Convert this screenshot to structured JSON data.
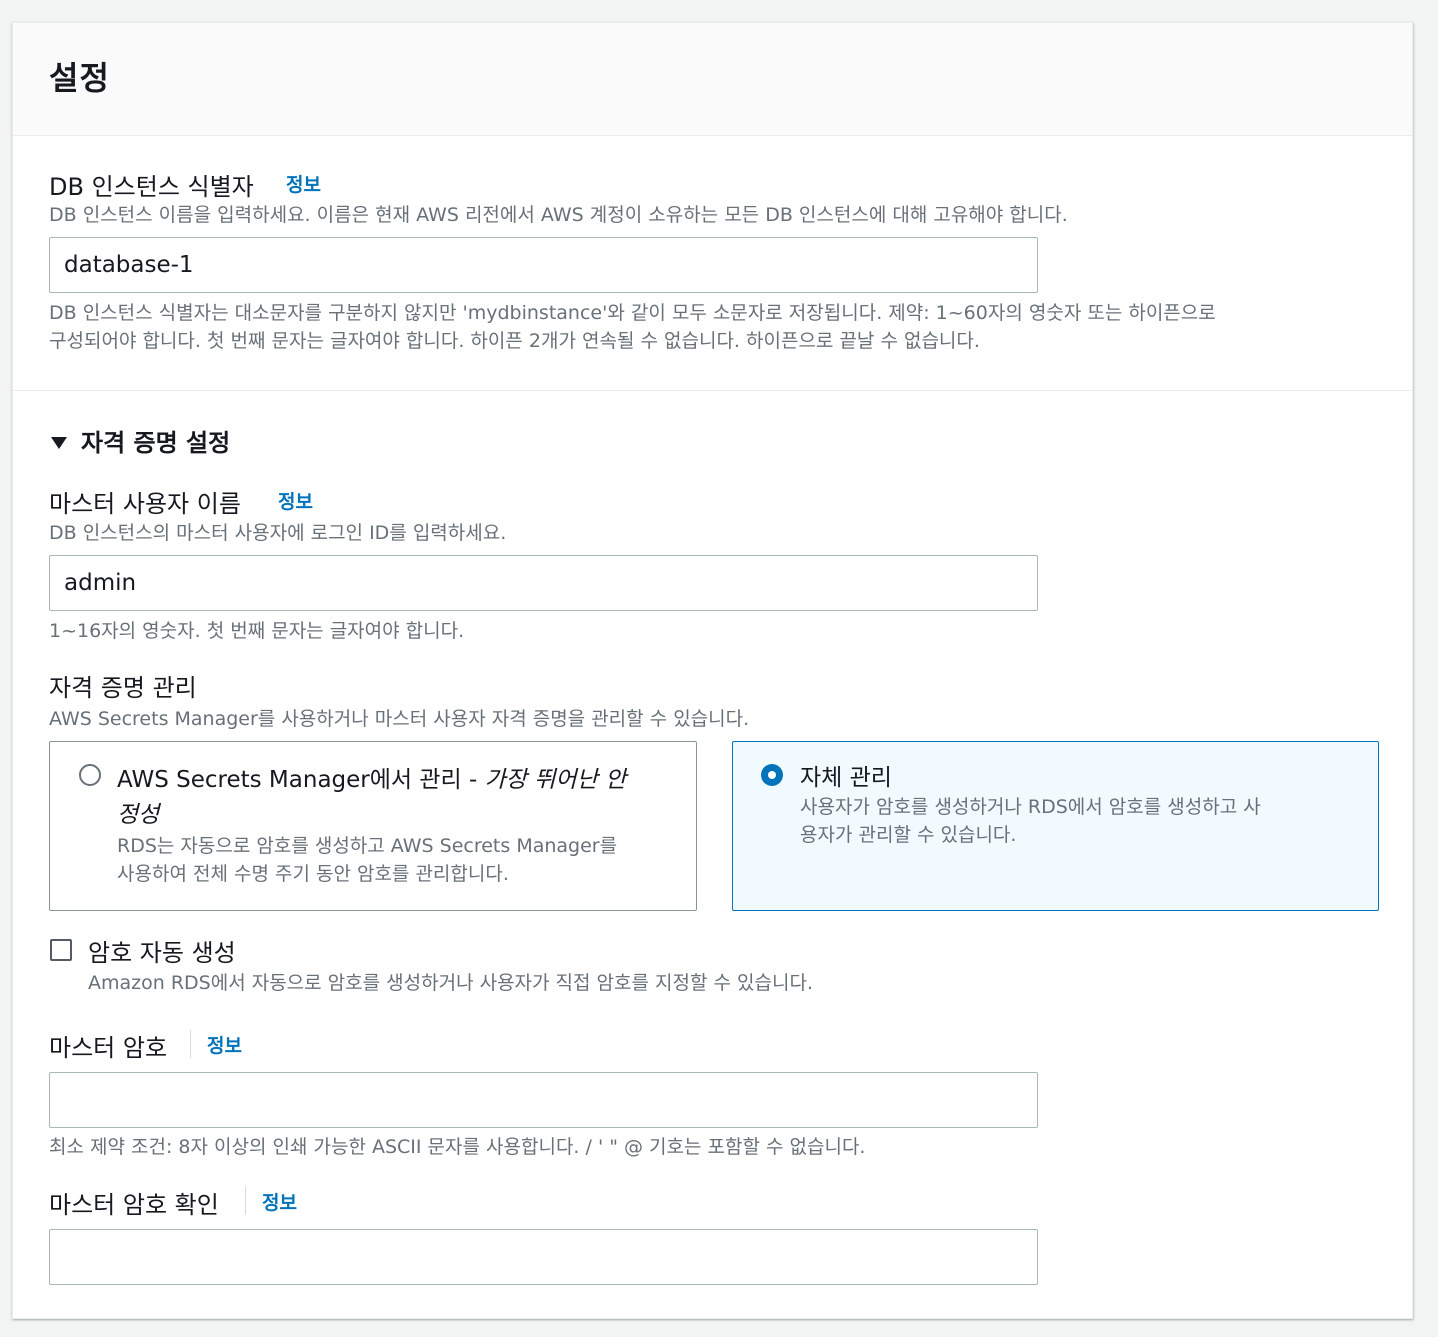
{
  "settings": {
    "title": "설정",
    "identifier": {
      "label": "DB 인스턴스 식별자",
      "info": "정보",
      "description": "DB 인스턴스 이름을 입력하세요. 이름은 현재 AWS 리전에서 AWS 계정이 소유하는 모든 DB 인스턴스에 대해 고유해야 합니다.",
      "value": "database-1",
      "constraint_line1": "DB 인스턴스 식별자는 대소문자를 구분하지 않지만 'mydbinstance'와 같이 모두 소문자로 저장됩니다. 제약: 1~60자의 영숫자 또는 하이픈으로",
      "constraint_line2": "구성되어야 합니다. 첫 번째 문자는 글자여야 합니다. 하이픈 2개가 연속될 수 없습니다. 하이픈으로 끝날 수 없습니다."
    },
    "credentials": {
      "section_title": "자격 증명 설정",
      "expander_icon": "caret-down-icon",
      "master_username": {
        "label": "마스터 사용자 이름",
        "info": "정보",
        "description": "DB 인스턴스의 마스터 사용자에 로그인 ID를 입력하세요.",
        "value": "admin",
        "constraint": "1~16자의 영숫자. 첫 번째 문자는 글자여야 합니다."
      },
      "management": {
        "label": "자격 증명 관리",
        "description": "AWS Secrets Manager를 사용하거나 마스터 사용자 자격 증명을 관리할 수 있습니다.",
        "options": [
          {
            "title_main": "AWS Secrets Manager에서 관리 - ",
            "title_emph_line1": "가장 뛰어난 안",
            "title_emph_line2": "정성",
            "desc_line1": "RDS는 자동으로 암호를 생성하고 AWS Secrets Manager를",
            "desc_line2": "사용하여 전체 수명 주기 동안 암호를 관리합니다.",
            "selected": false
          },
          {
            "title": "자체 관리",
            "desc_line1": "사용자가 암호를 생성하거나 RDS에서 암호를 생성하고 사",
            "desc_line2": "용자가 관리할 수 있습니다.",
            "selected": true
          }
        ]
      },
      "auto_generate": {
        "label": "암호 자동 생성",
        "description": "Amazon RDS에서 자동으로 암호를 생성하거나 사용자가 직접 암호를 지정할 수 있습니다.",
        "checked": false
      },
      "master_password": {
        "label": "마스터 암호",
        "info": "정보",
        "value": "",
        "constraint": "최소 제약 조건: 8자 이상의 인쇄 가능한 ASCII 문자를 사용합니다. / ' \" @ 기호는 포함할 수 없습니다."
      },
      "confirm_password": {
        "label": "마스터 암호 확인",
        "info": "정보",
        "value": ""
      }
    }
  },
  "colors": {
    "link": "#0073bb",
    "selected_border": "#0073bb",
    "selected_bg": "#f1faff",
    "description_text": "#687078"
  }
}
